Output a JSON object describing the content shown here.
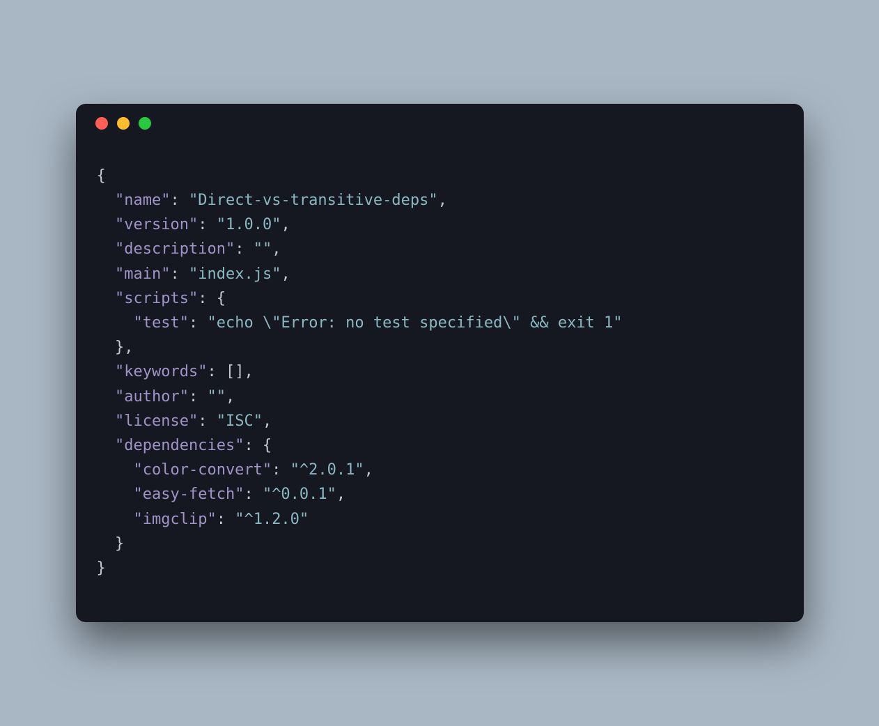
{
  "traffic_lights": {
    "close": "close",
    "minimize": "minimize",
    "zoom": "zoom"
  },
  "code": {
    "open_brace": "{",
    "close_brace": "}",
    "open_bracket": "[",
    "close_bracket": "]",
    "comma": ",",
    "colon": ":",
    "quote": "\"",
    "escaped_quote": "\\\"",
    "name_key": "name",
    "name_val": "Direct-vs-transitive-deps",
    "version_key": "version",
    "version_val": "1.0.0",
    "description_key": "description",
    "description_val": "",
    "main_key": "main",
    "main_val": "index.js",
    "scripts_key": "scripts",
    "test_key": "test",
    "test_val_prefix": "echo ",
    "test_val_mid": "Error: no test specified",
    "test_val_suffix": " && exit 1",
    "keywords_key": "keywords",
    "author_key": "author",
    "author_val": "",
    "license_key": "license",
    "license_val": "ISC",
    "dependencies_key": "dependencies",
    "dep1_key": "color-convert",
    "dep1_val": "^2.0.1",
    "dep2_key": "easy-fetch",
    "dep2_val": "^0.0.1",
    "dep3_key": "imgclip",
    "dep3_val": "^1.2.0"
  }
}
